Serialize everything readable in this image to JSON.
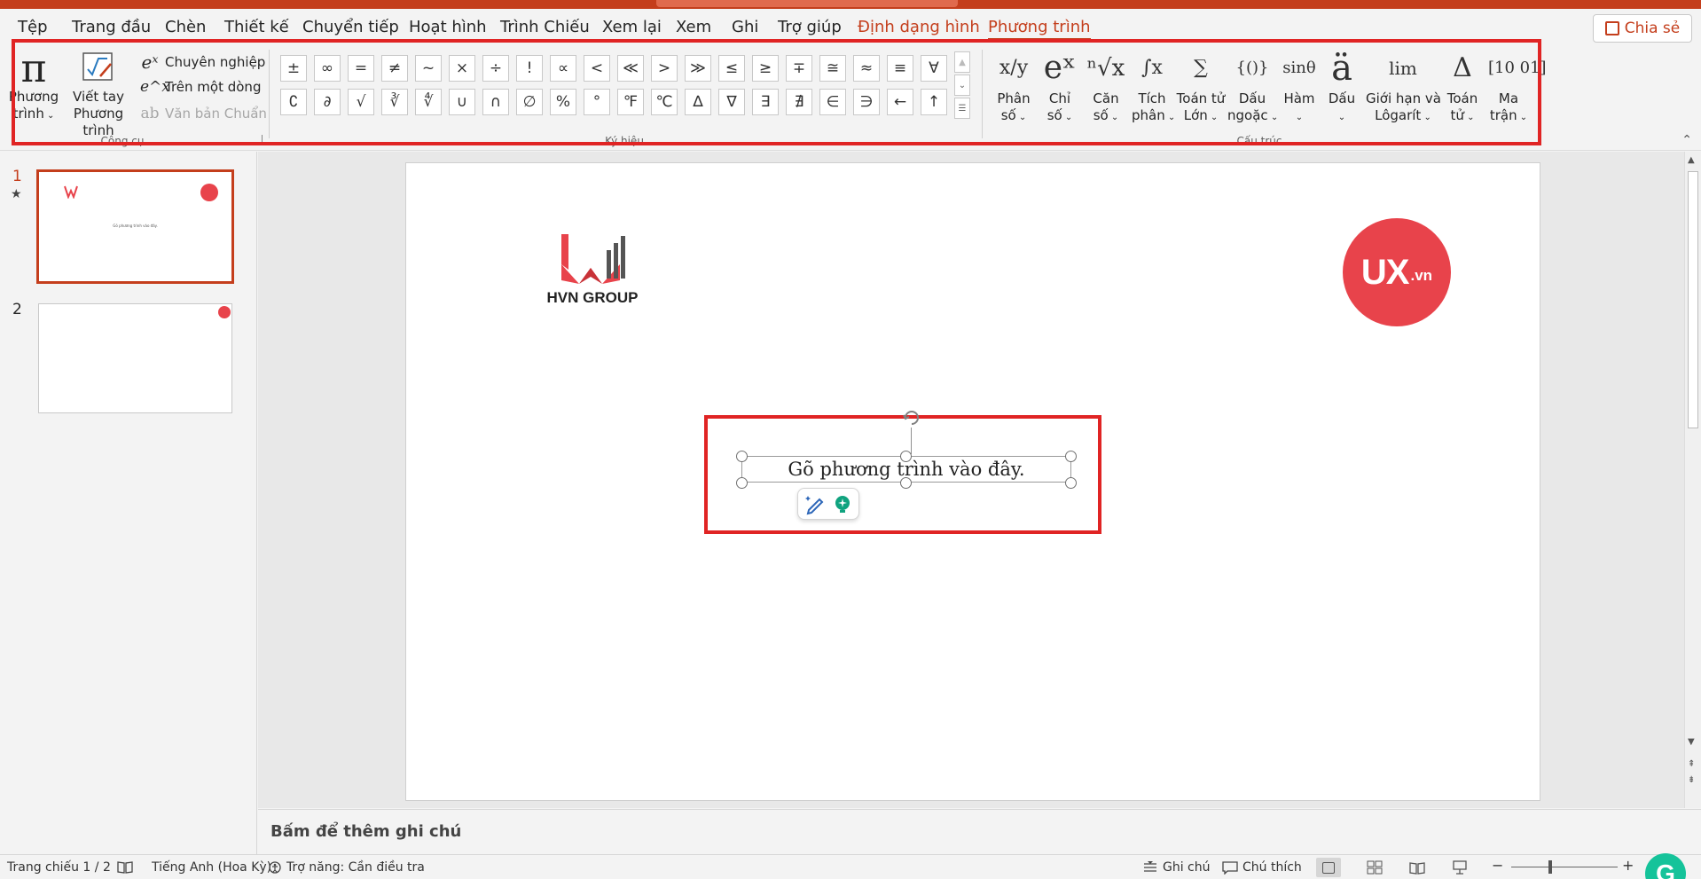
{
  "menu": {
    "items": [
      "Tệp",
      "Trang đầu",
      "Chèn",
      "Thiết kế",
      "Chuyển tiếp",
      "Hoạt hình",
      "Trình Chiếu",
      "Xem lại",
      "Xem",
      "Ghi",
      "Trợ giúp",
      "Định dạng hình",
      "Phương trình"
    ],
    "share_label": "Chia sẻ"
  },
  "ribbon": {
    "tools": {
      "group_label": "Công cụ",
      "equation_btn": [
        "Phương",
        "trình"
      ],
      "ink_btn": [
        "Viết tay",
        "Phương trình"
      ],
      "professional": "Chuyên nghiệp",
      "linear": "Trên một dòng",
      "normal_text": "Văn bản Chuẩn"
    },
    "symbols": {
      "group_label": "Ký hiệu",
      "row1": [
        "±",
        "∞",
        "=",
        "≠",
        "~",
        "×",
        "÷",
        "!",
        "∝",
        "<",
        "≪",
        ">",
        "≫",
        "≤",
        "≥",
        "∓",
        "≅",
        "≈",
        "≡",
        "∀"
      ],
      "row2": [
        "∁",
        "∂",
        "√",
        "∛",
        "∜",
        "∪",
        "∩",
        "∅",
        "%",
        "°",
        "℉",
        "℃",
        "∆",
        "∇",
        "∃",
        "∄",
        "∈",
        "∋",
        "←",
        "↑"
      ]
    },
    "structures": {
      "group_label": "Cấu trúc",
      "items": [
        {
          "glyph": "x/y",
          "line1": "Phân",
          "line2": "số"
        },
        {
          "glyph": "eˣ",
          "line1": "Chỉ",
          "line2": "số"
        },
        {
          "glyph": "ⁿ√x",
          "line1": "Căn",
          "line2": "số"
        },
        {
          "glyph": "∫x",
          "line1": "Tích",
          "line2": "phân"
        },
        {
          "glyph": "∑",
          "line1": "Toán tử",
          "line2": "Lớn"
        },
        {
          "glyph": "{()}",
          "line1": "Dấu",
          "line2": "ngoặc"
        },
        {
          "glyph": "sinθ",
          "line1": "Hàm",
          "line2": ""
        },
        {
          "glyph": "ä",
          "line1": "Dấu",
          "line2": ""
        },
        {
          "glyph": "lim",
          "line1": "Giới hạn và",
          "line2": "Lôgarít"
        },
        {
          "glyph": "Δ",
          "line1": "Toán",
          "line2": "tử"
        },
        {
          "glyph": "[10 01]",
          "line1": "Ma",
          "line2": "trận"
        }
      ]
    }
  },
  "thumbnails": [
    {
      "number": "1",
      "mini_text": "Gõ phương trình vào đây."
    },
    {
      "number": "2"
    }
  ],
  "slide": {
    "hvn_text": "HVN GROUP",
    "ux_main": "UX",
    "ux_sub": ".vn",
    "equation_placeholder": "Gõ phương trình vào đây."
  },
  "notes_placeholder": "Bấm để thêm ghi chú",
  "status": {
    "slide_count": "Trang chiếu 1 / 2",
    "language": "Tiếng Anh (Hoa Kỳ)",
    "accessibility": "Trợ năng: Cần điều tra",
    "notes": "Ghi chú",
    "comments": "Chú thích"
  },
  "colors": {
    "accent": "#c43e1c",
    "highlight": "#e02424",
    "ux_red": "#e8434b",
    "grammarly": "#15c39a"
  }
}
